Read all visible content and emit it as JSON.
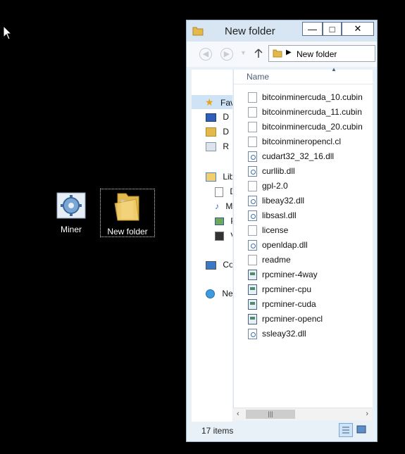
{
  "desktop": {
    "icons": [
      {
        "label": "Miner"
      },
      {
        "label": "New folder"
      }
    ]
  },
  "window": {
    "title": "New folder",
    "buttons": {
      "minimize": "—",
      "maximize": "□",
      "close": "✕"
    },
    "address": {
      "path": "New folder"
    },
    "nav": {
      "items": [
        {
          "label": "Fav"
        },
        {
          "label": "D"
        },
        {
          "label": "D"
        },
        {
          "label": "R"
        },
        {
          "label": "Lib"
        },
        {
          "label": "D"
        },
        {
          "label": "M"
        },
        {
          "label": "P"
        },
        {
          "label": "V"
        },
        {
          "label": "Co"
        },
        {
          "label": "Ne"
        }
      ]
    },
    "files": {
      "column_header": "Name",
      "items": [
        {
          "name": "bitcoinminercuda_10.cubin",
          "icon": "doc"
        },
        {
          "name": "bitcoinminercuda_11.cubin",
          "icon": "doc"
        },
        {
          "name": "bitcoinminercuda_20.cubin",
          "icon": "doc"
        },
        {
          "name": "bitcoinmineropencl.cl",
          "icon": "doc"
        },
        {
          "name": "cudart32_32_16.dll",
          "icon": "dll"
        },
        {
          "name": "curllib.dll",
          "icon": "dll"
        },
        {
          "name": "gpl-2.0",
          "icon": "doc"
        },
        {
          "name": "libeay32.dll",
          "icon": "dll"
        },
        {
          "name": "libsasl.dll",
          "icon": "dll"
        },
        {
          "name": "license",
          "icon": "doc"
        },
        {
          "name": "openldap.dll",
          "icon": "dll"
        },
        {
          "name": "readme",
          "icon": "doc"
        },
        {
          "name": "rpcminer-4way",
          "icon": "exe"
        },
        {
          "name": "rpcminer-cpu",
          "icon": "exe"
        },
        {
          "name": "rpcminer-cuda",
          "icon": "exe"
        },
        {
          "name": "rpcminer-opencl",
          "icon": "exe"
        },
        {
          "name": "ssleay32.dll",
          "icon": "dll"
        }
      ]
    },
    "status": {
      "item_count": "17 items"
    }
  }
}
